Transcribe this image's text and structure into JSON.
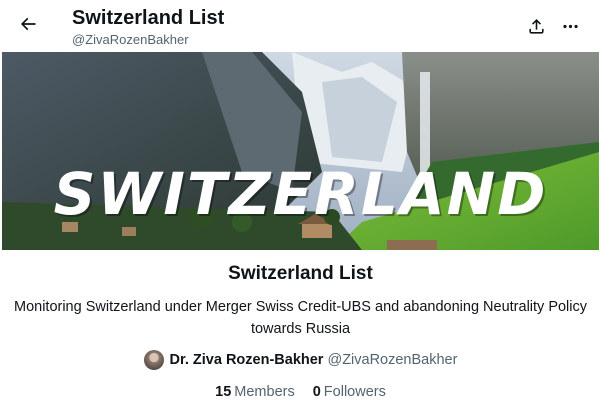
{
  "header": {
    "title": "Switzerland List",
    "handle": "@ZivaRozenBakher",
    "back_icon": "arrow-left-icon",
    "share_icon": "share-icon",
    "more_icon": "more-horizontal-icon"
  },
  "banner": {
    "text": "SWITZERLAND"
  },
  "list": {
    "title": "Switzerland List",
    "description": "Monitoring Switzerland under Merger Swiss Credit-UBS and abandoning Neutrality Policy towards Russia"
  },
  "owner": {
    "name": "Dr. Ziva Rozen-Bakher",
    "handle": "@ZivaRozenBakher"
  },
  "stats": {
    "members_count": "15",
    "members_label": "Members",
    "followers_count": "0",
    "followers_label": "Followers"
  },
  "colors": {
    "text_primary": "#0f1419",
    "text_secondary": "#536471",
    "background": "#ffffff"
  }
}
